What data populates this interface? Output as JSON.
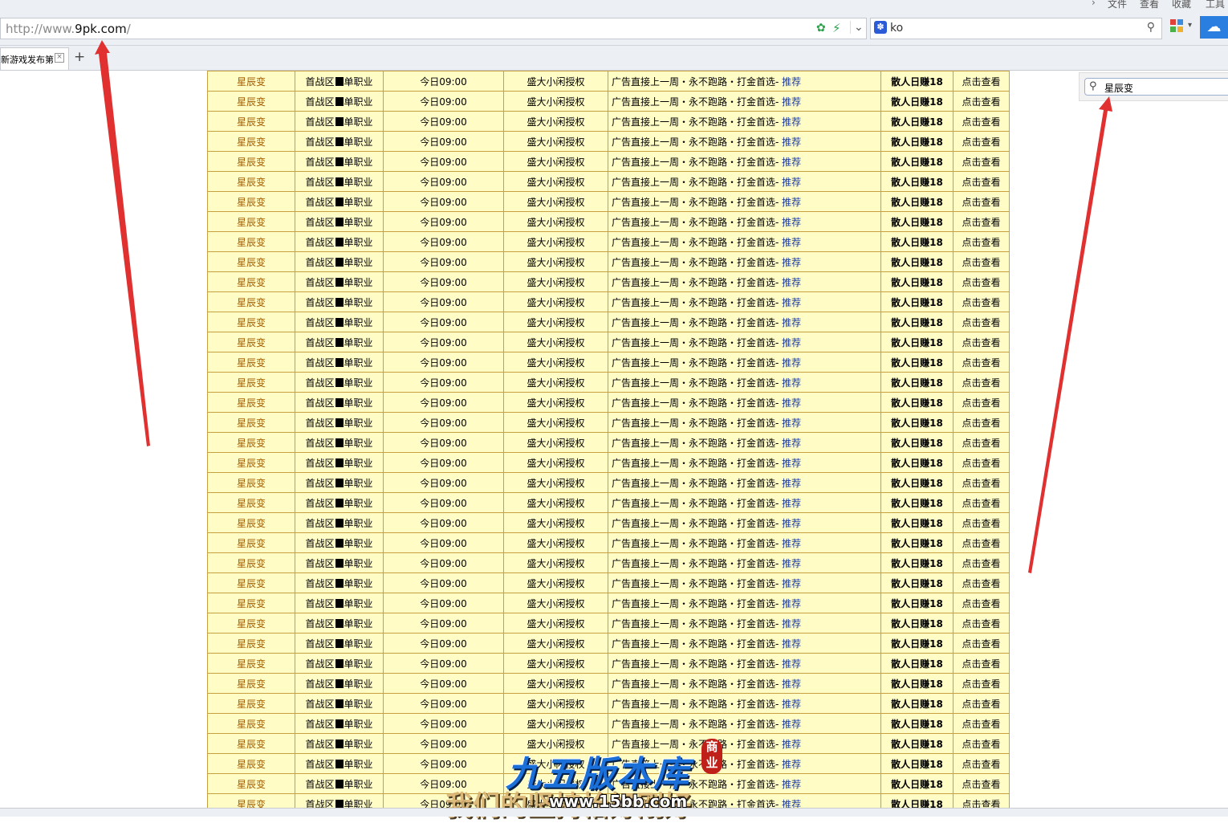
{
  "browser": {
    "menu": [
      "文件",
      "查看",
      "收藏",
      "工具"
    ],
    "address": {
      "prefix": "http://www.",
      "domain": "9pk.com",
      "suffix": "/"
    },
    "search_value": "ko",
    "tab_title": "新游戏发布第",
    "new_tab": "+"
  },
  "page": {
    "side_search_value": "星辰变",
    "row_template": {
      "name": "星辰变",
      "zone_pre": "首战区",
      "zone_post": "单职业",
      "time": "今日09:00",
      "category": "盛大小闲授权",
      "desc": "广告直接上一周・永不跑路・打金首选-",
      "desc_tag": "推荐",
      "rate": "散人日赚18",
      "action": "点击查看"
    },
    "row_count": 37
  },
  "watermark": {
    "title": "九五版本库",
    "badge": "商业",
    "url": "www.15bb.com",
    "slogan": "我们的坚持恰好刚好"
  },
  "colors": {
    "row_bg": "#fffcc6",
    "border": "#c8a040",
    "name": "#a35d00",
    "tag": "#1a3aa0",
    "arrow": "#e03030"
  }
}
